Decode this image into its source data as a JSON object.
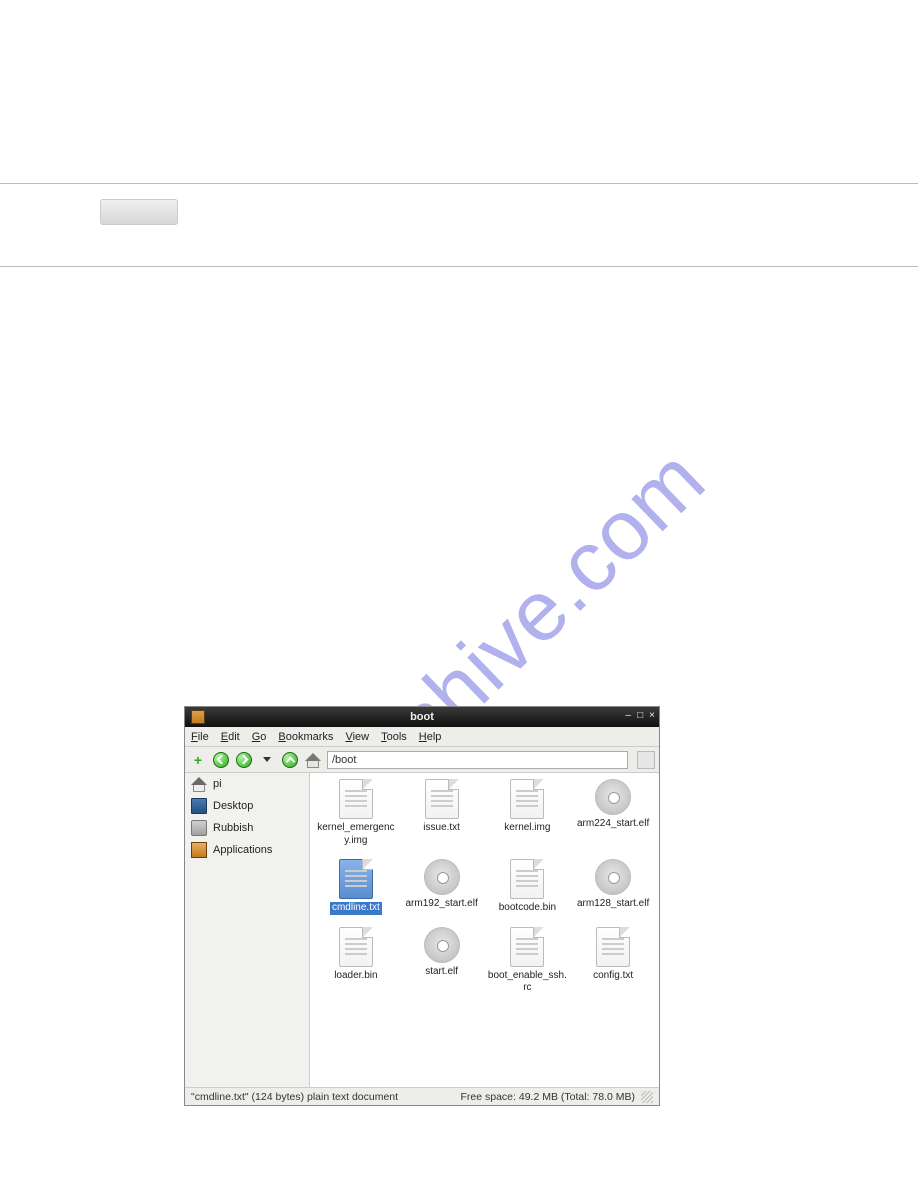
{
  "watermark": "manualshive.com",
  "fm": {
    "title": "boot",
    "menu": {
      "file": "File",
      "edit": "Edit",
      "go": "Go",
      "bookmarks": "Bookmarks",
      "view": "View",
      "tools": "Tools",
      "help": "Help"
    },
    "path": "/boot",
    "sidebar": [
      {
        "icon": "home",
        "label": "pi"
      },
      {
        "icon": "desk",
        "label": "Desktop"
      },
      {
        "icon": "trash",
        "label": "Rubbish"
      },
      {
        "icon": "apps",
        "label": "Applications"
      }
    ],
    "files": [
      {
        "type": "doc",
        "name": "kernel_emergency.img",
        "selected": false
      },
      {
        "type": "doc",
        "name": "issue.txt",
        "selected": false
      },
      {
        "type": "doc",
        "name": "kernel.img",
        "selected": false
      },
      {
        "type": "gear",
        "name": "arm224_start.elf",
        "selected": false
      },
      {
        "type": "doc",
        "name": "cmdline.txt",
        "selected": true
      },
      {
        "type": "gear",
        "name": "arm192_start.elf",
        "selected": false
      },
      {
        "type": "doc",
        "name": "bootcode.bin",
        "selected": false
      },
      {
        "type": "gear",
        "name": "arm128_start.elf",
        "selected": false
      },
      {
        "type": "doc",
        "name": "loader.bin",
        "selected": false
      },
      {
        "type": "gear",
        "name": "start.elf",
        "selected": false
      },
      {
        "type": "doc",
        "name": "boot_enable_ssh.rc",
        "selected": false
      },
      {
        "type": "doc",
        "name": "config.txt",
        "selected": false
      }
    ],
    "status_left": "\"cmdline.txt\" (124 bytes) plain text document",
    "status_right": "Free space: 49.2 MB (Total: 78.0 MB)"
  },
  "window_controls": {
    "min": "–",
    "max": "□",
    "close": "×"
  }
}
